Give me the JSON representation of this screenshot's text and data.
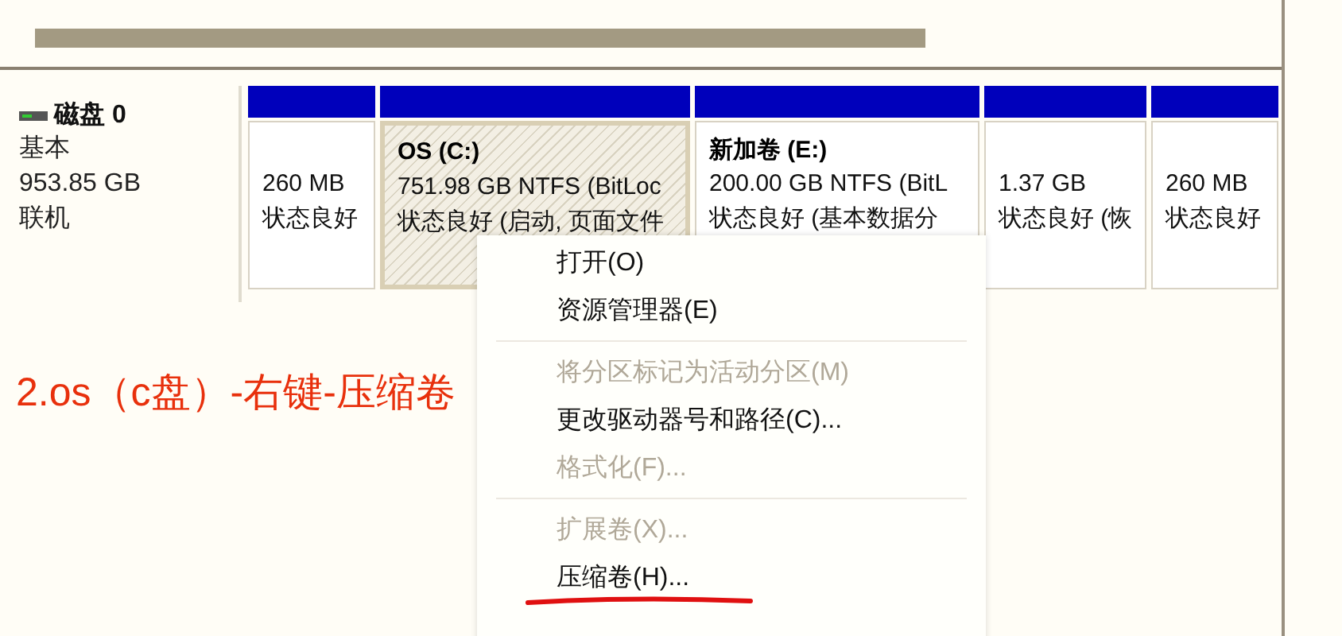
{
  "disk": {
    "name": "磁盘 0",
    "type": "基本",
    "size": "953.85 GB",
    "status": "联机"
  },
  "partitions": [
    {
      "size": "260 MB",
      "status": "状态良好",
      "selected": false
    },
    {
      "label": "OS  (C:)",
      "size": "751.98 GB NTFS (BitLoc",
      "status": "状态良好 (启动, 页面文件",
      "selected": true
    },
    {
      "label": "新加卷  (E:)",
      "size": "200.00 GB NTFS (BitL",
      "status": "状态良好 (基本数据分",
      "selected": false
    },
    {
      "size": "1.37 GB",
      "status": "状态良好 (恢",
      "selected": false
    },
    {
      "size": "260 MB",
      "status": "状态良好",
      "selected": false
    }
  ],
  "annotation": "2.os（c盘）-右键-压缩卷",
  "context_menu": [
    {
      "kind": "item",
      "label": "打开(O)",
      "disabled": false
    },
    {
      "kind": "item",
      "label": "资源管理器(E)",
      "disabled": false
    },
    {
      "kind": "separator"
    },
    {
      "kind": "item",
      "label": "将分区标记为活动分区(M)",
      "disabled": true
    },
    {
      "kind": "item",
      "label": "更改驱动器号和路径(C)...",
      "disabled": false
    },
    {
      "kind": "item",
      "label": "格式化(F)...",
      "disabled": true
    },
    {
      "kind": "separator"
    },
    {
      "kind": "item",
      "label": "扩展卷(X)...",
      "disabled": true
    },
    {
      "kind": "item",
      "label": "压缩卷(H)...",
      "disabled": false,
      "underlined": true
    }
  ]
}
